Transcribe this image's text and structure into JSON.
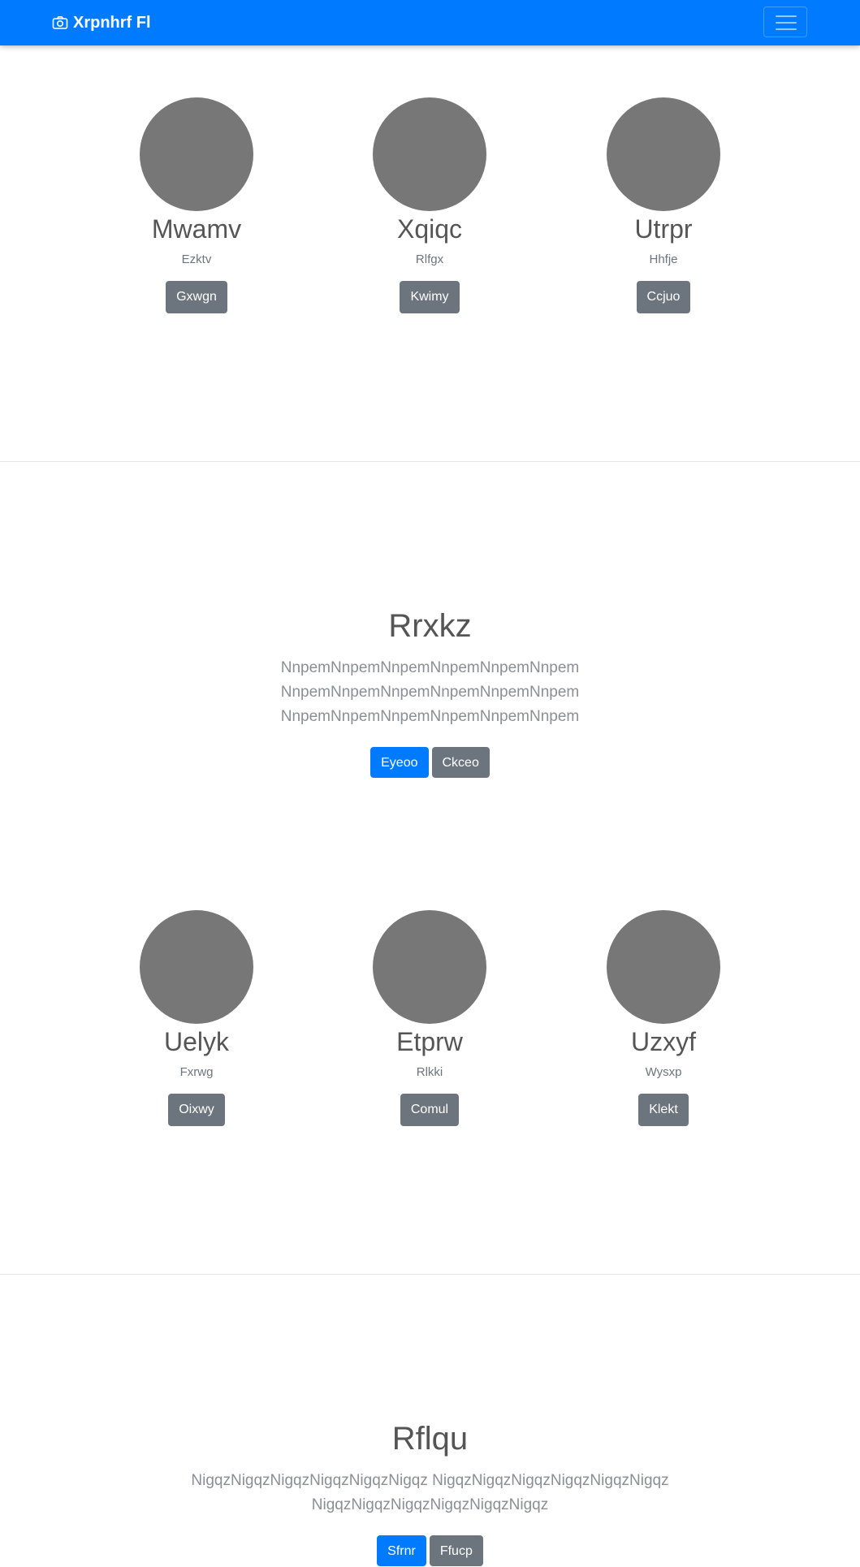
{
  "navbar": {
    "brand": "Xrpnhrf Fl",
    "brand_icon": "camera-icon",
    "toggler_icon": "hamburger-menu-icon",
    "color": "#007bff"
  },
  "team1": [
    {
      "name": "Mwamv",
      "role": "Ezktv",
      "button": "Gxwgn"
    },
    {
      "name": "Xqiqc",
      "role": "Rlfgx",
      "button": "Kwimy"
    },
    {
      "name": "Utrpr",
      "role": "Hhfje",
      "button": "Ccjuo"
    }
  ],
  "cta1": {
    "title": "Rrxkz",
    "lines": [
      "NnpemNnpemNnpemNnpemNnpemNnpem",
      "NnpemNnpemNnpemNnpemNnpemNnpem",
      "NnpemNnpemNnpemNnpemNnpemNnpem"
    ],
    "primary": "Eyeoo",
    "secondary": "Ckceo"
  },
  "team2": [
    {
      "name": "Uelyk",
      "role": "Fxrwg",
      "button": "Oixwy"
    },
    {
      "name": "Etprw",
      "role": "Rlkki",
      "button": "Comul"
    },
    {
      "name": "Uzxyf",
      "role": "Wysxp",
      "button": "Klekt"
    }
  ],
  "cta2": {
    "title": "Rflqu",
    "lines": [
      "NigqzNigqzNigqzNigqzNigqzNigqz NigqzNigqzNigqzNigqzNigqzNigqz",
      "NigqzNigqzNigqzNigqzNigqzNigqz"
    ],
    "primary": "Sfrnr",
    "secondary": "Ffucp"
  }
}
